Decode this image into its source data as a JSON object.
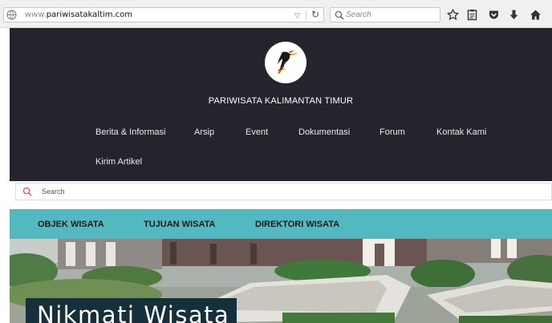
{
  "browser": {
    "url_prefix": "www.",
    "url_domain": "pariwisatakaltim.com",
    "search_placeholder": "Search"
  },
  "site": {
    "title": "PARIWISATA KALIMANTAN TIMUR",
    "nav": [
      {
        "label": "Berita & Informasi"
      },
      {
        "label": "Arsip"
      },
      {
        "label": "Event"
      },
      {
        "label": "Dokumentasi"
      },
      {
        "label": "Forum"
      },
      {
        "label": "Kontak Kami"
      },
      {
        "label": "Kirim Artikel"
      }
    ],
    "search_placeholder": "Search",
    "category_nav": [
      {
        "label": "OBJEK WISATA"
      },
      {
        "label": "TUJUAN WISATA"
      },
      {
        "label": "DIREKTORI WISATA"
      }
    ],
    "hero_caption": "Nikmati Wisata"
  },
  "colors": {
    "header_bg": "#27232d",
    "accent_teal": "#51b9bf",
    "caption_bg": "#15303a"
  }
}
